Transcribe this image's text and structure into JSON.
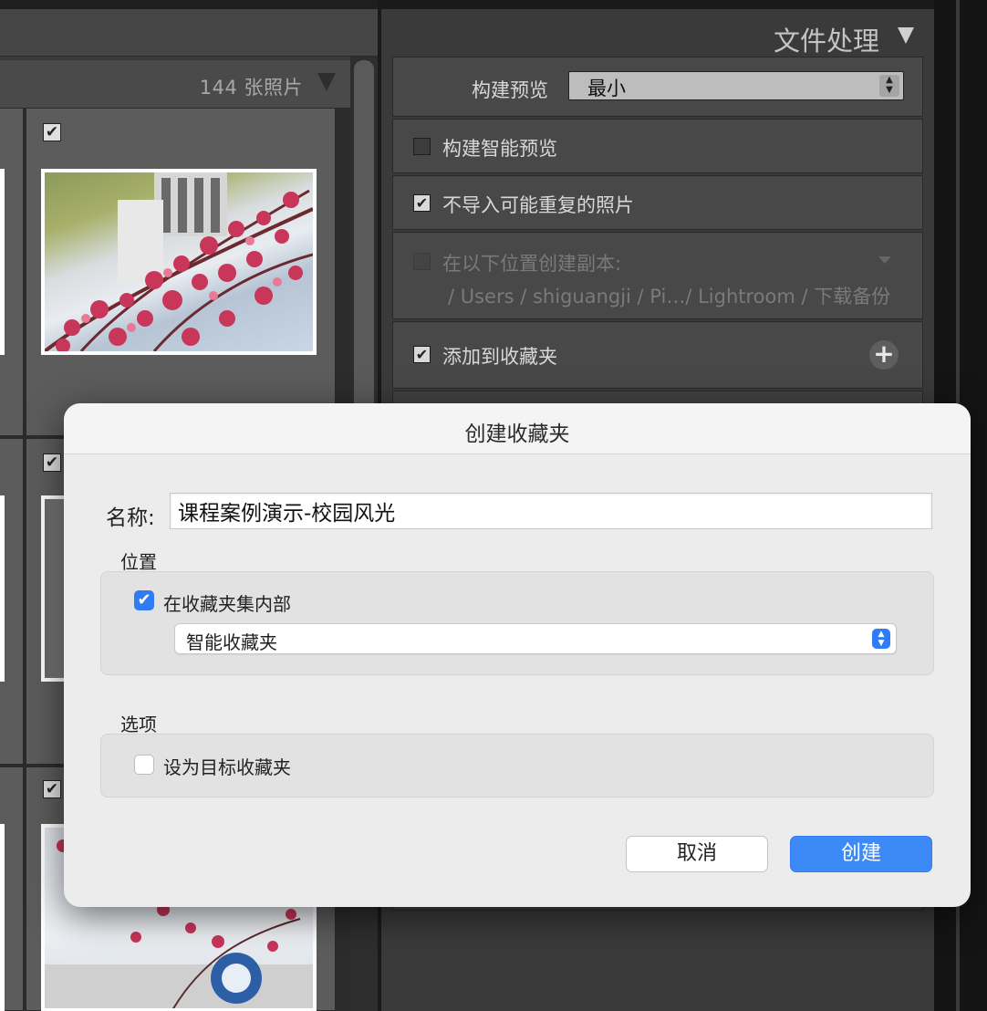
{
  "grid": {
    "photo_count": "144 张照片",
    "check_mark": "✔"
  },
  "file_handling": {
    "title": "文件处理",
    "build_preview_label": "构建预览",
    "build_preview_value": "最小",
    "smart_preview_label": "构建智能预览",
    "smart_preview_checked": false,
    "no_duplicates_label": "不导入可能重复的照片",
    "no_duplicates_checked": true,
    "make_copy_label": "在以下位置创建副本:",
    "make_copy_checked": false,
    "make_copy_path": "/ Users / shiguangji / Pi…/ Lightroom / 下载备份",
    "add_to_collection_label": "添加到收藏夹",
    "add_to_collection_checked": true,
    "plus_icon": "+"
  },
  "dialog": {
    "title": "创建收藏夹",
    "name_label": "名称:",
    "name_value": "课程案例演示-校园风光",
    "location_section": "位置",
    "inside_set_label": "在收藏夹集内部",
    "inside_set_checked": true,
    "collection_set_value": "智能收藏夹",
    "options_section": "选项",
    "set_target_label": "设为目标收藏夹",
    "set_target_checked": false,
    "cancel_label": "取消",
    "create_label": "创建"
  },
  "colors": {
    "accent": "#2f7cf6",
    "panel_bg": "#3a3a3a",
    "dialog_bg": "#ececec"
  }
}
